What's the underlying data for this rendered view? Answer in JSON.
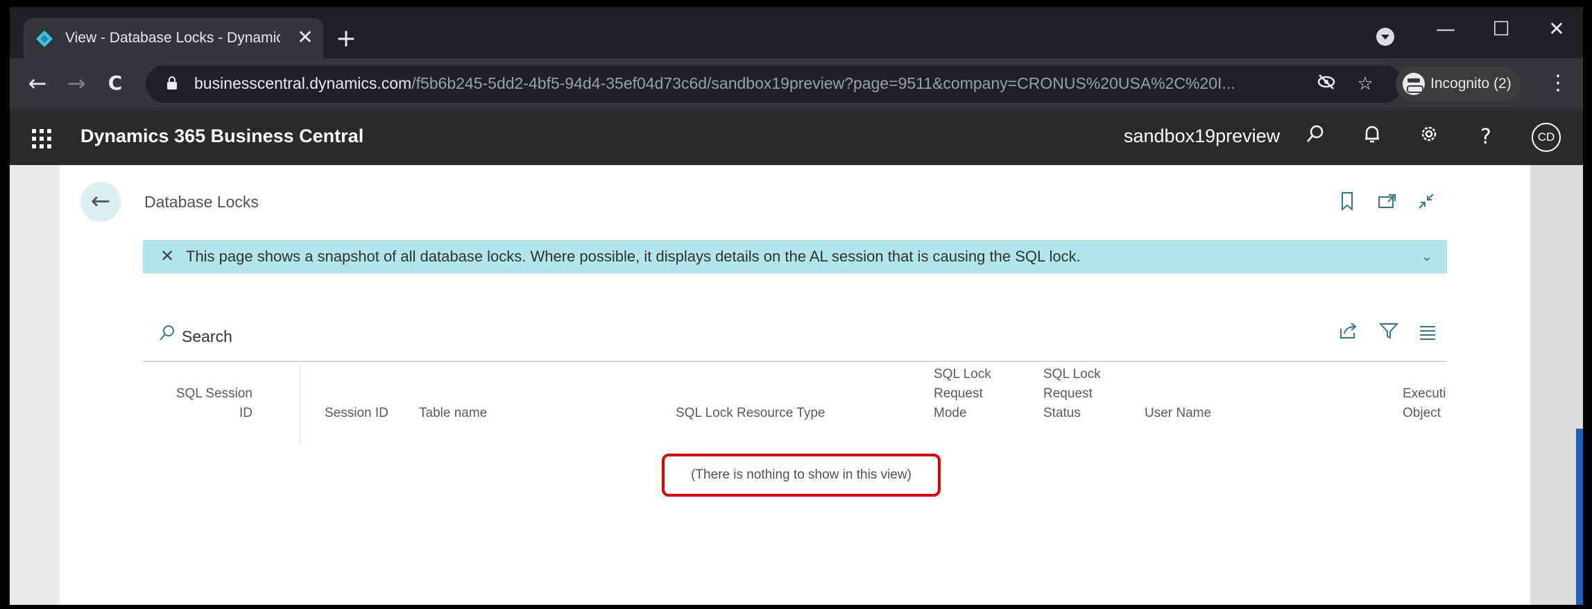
{
  "browser": {
    "tab_title": "View - Database Locks - Dynamic",
    "tab_close": "✕",
    "new_tab": "+",
    "url_host": "businesscentral.dynamics.com",
    "url_path": "/f5b6b245-5dd2-4bf5-94d4-35ef04d73c6d/sandbox19preview?page=9511&company=CRONUS%20USA%2C%20I...",
    "incognito_label": "Incognito (2)",
    "window_minimize": "—",
    "window_maximize": "☐",
    "window_close": "✕",
    "back": "←",
    "forward": "→",
    "reload": "C",
    "kebab": "⋮"
  },
  "appbar": {
    "title": "Dynamics 365 Business Central",
    "environment": "sandbox19preview",
    "avatar_initials": "CD",
    "icons": [
      "search-icon",
      "bell-icon",
      "gear-icon",
      "help-icon"
    ]
  },
  "page": {
    "back_glyph": "←",
    "title": "Database Locks",
    "banner_text": "This page shows a snapshot of all database locks. Where possible, it displays details on the AL session that is causing the SQL lock.",
    "banner_close": "✕",
    "banner_chevron": "⌄"
  },
  "list": {
    "search_label": "Search",
    "columns": [
      "SQL Session\nID",
      "Session ID",
      "Table name",
      "SQL Lock Resource Type",
      "SQL Lock\nRequest\nMode",
      "SQL Lock\nRequest\nStatus",
      "User Name",
      "Executi\nObject"
    ],
    "empty_message": "(There is nothing to show in this view)"
  },
  "colors": {
    "browser_dark": "#202124",
    "app_bar": "#2a2a2a",
    "accent": "#2d7b8c",
    "banner": "#b0e6eb",
    "highlight": "#e00000"
  }
}
